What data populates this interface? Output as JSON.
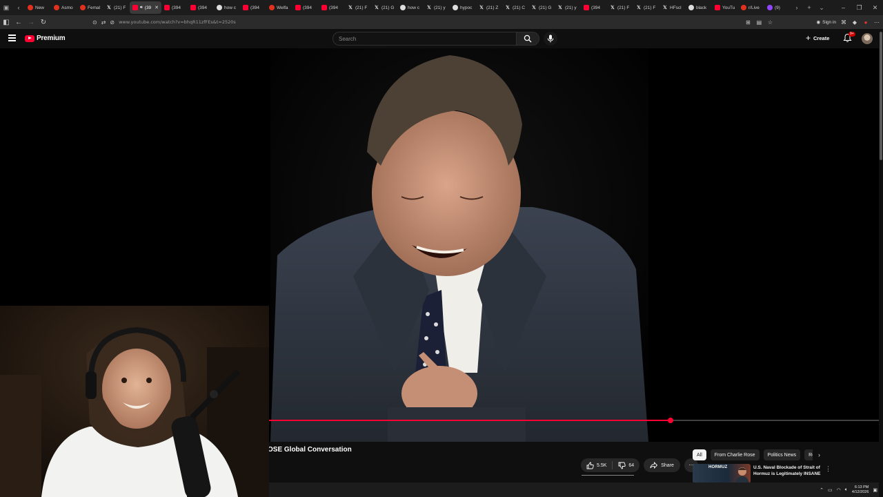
{
  "browser": {
    "tabs": [
      {
        "icon": "reddit",
        "label": "New"
      },
      {
        "icon": "reddit",
        "label": "Asmo"
      },
      {
        "icon": "reddit",
        "label": "Femal"
      },
      {
        "icon": "x",
        "label": "(21) F"
      },
      {
        "icon": "youtube",
        "label": "(39",
        "active": true
      },
      {
        "icon": "youtube",
        "label": "(394"
      },
      {
        "icon": "youtube",
        "label": "(394"
      },
      {
        "icon": "google",
        "label": "how c"
      },
      {
        "icon": "youtube",
        "label": "(394"
      },
      {
        "icon": "reddit",
        "label": "Welfa"
      },
      {
        "icon": "youtube",
        "label": "(394"
      },
      {
        "icon": "youtube",
        "label": "(394"
      },
      {
        "icon": "x",
        "label": "(21) F"
      },
      {
        "icon": "x",
        "label": "(21) G"
      },
      {
        "icon": "google",
        "label": "how c"
      },
      {
        "icon": "x",
        "label": "(21) y"
      },
      {
        "icon": "google",
        "label": "hypoc"
      },
      {
        "icon": "x",
        "label": "(21) Z"
      },
      {
        "icon": "x",
        "label": "(21) C"
      },
      {
        "icon": "x",
        "label": "(21) G"
      },
      {
        "icon": "x",
        "label": "(21) y"
      },
      {
        "icon": "youtube",
        "label": "(394"
      },
      {
        "icon": "x",
        "label": "(21) F"
      },
      {
        "icon": "x",
        "label": "(21) F"
      },
      {
        "icon": "x",
        "label": "HFscl"
      },
      {
        "icon": "google",
        "label": "black"
      },
      {
        "icon": "youtube",
        "label": "YouTu"
      },
      {
        "icon": "reddit",
        "label": "r/Live"
      },
      {
        "icon": "twitch",
        "label": "(9)"
      }
    ],
    "url": "www.youtube.com/watch?v=bhqR11zfFEs&t=2520s",
    "sign_in_label": "Sign in"
  },
  "youtube": {
    "logo_text": "Premium",
    "search_placeholder": "Search",
    "create_label": "Create",
    "notifications_badge": "9+"
  },
  "player": {
    "progress": 0.658
  },
  "video": {
    "title": "OSE Global Conversation",
    "likes": "5.5K",
    "dislikes": "64",
    "share_label": "Share"
  },
  "chips": [
    {
      "label": "All",
      "active": true
    },
    {
      "label": "From Charlie Rose"
    },
    {
      "label": "Politics News"
    },
    {
      "label": "Re"
    }
  ],
  "recommendation": {
    "thumb_text": "HORMUZ",
    "title": "U.S. Naval Blockade of Strait of Hormuz is Legitimately INSANE"
  },
  "taskbar": {
    "time": "6:13 PM",
    "date": "4/12/2026"
  },
  "colors": {
    "accent": "#ff0033",
    "background": "#0f0f0f",
    "chip_bg": "#272727"
  }
}
